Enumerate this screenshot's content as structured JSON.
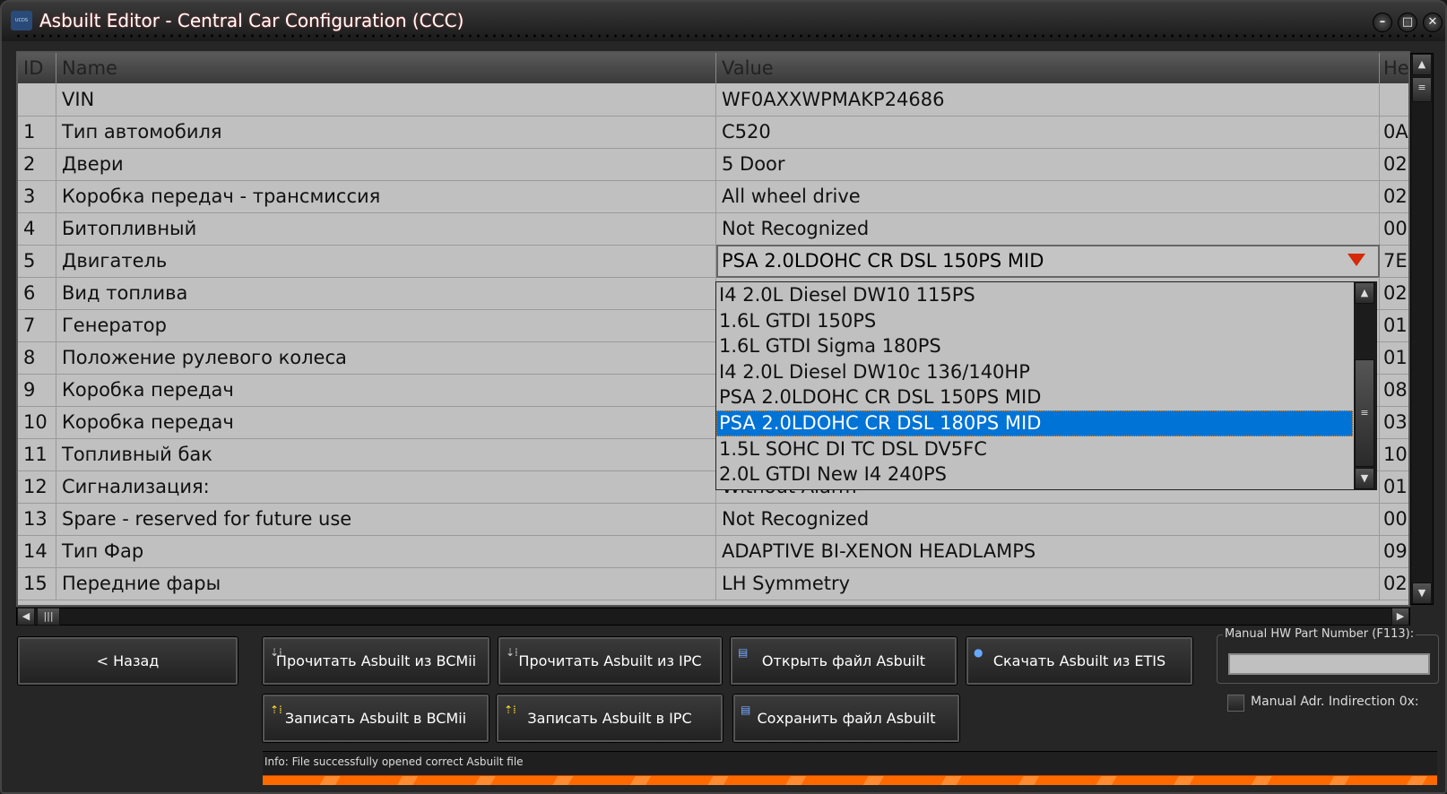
{
  "window": {
    "title": "Asbuilt Editor - Central Car Configuration (CCC)",
    "logo_text": "UCDS"
  },
  "table": {
    "columns": [
      "ID",
      "Name",
      "Value",
      "He"
    ],
    "rows": [
      {
        "id": "",
        "name": "VIN",
        "value": "WF0AXXWPMAKP24686",
        "hex": ""
      },
      {
        "id": "1",
        "name": "Тип автомобиля",
        "value": "C520",
        "hex": "0A"
      },
      {
        "id": "2",
        "name": "Двери",
        "value": "5 Door",
        "hex": "02"
      },
      {
        "id": "3",
        "name": "Коробка передач - трансмиссия",
        "value": "All wheel drive",
        "hex": "02"
      },
      {
        "id": "4",
        "name": "Битопливный",
        "value": "Not Recognized",
        "hex": "00"
      },
      {
        "id": "5",
        "name": "Двигатель",
        "value": "PSA 2.0LDOHC CR DSL 150PS MID",
        "hex": "7E"
      },
      {
        "id": "6",
        "name": "Вид топлива",
        "value": "",
        "hex": "02"
      },
      {
        "id": "7",
        "name": "Генератор",
        "value": "",
        "hex": "01"
      },
      {
        "id": "8",
        "name": "Положение рулевого колеса",
        "value": "",
        "hex": "01"
      },
      {
        "id": "9",
        "name": "Коробка передач",
        "value": "",
        "hex": "08"
      },
      {
        "id": "10",
        "name": "Коробка передач",
        "value": "",
        "hex": "03"
      },
      {
        "id": "11",
        "name": "Топливный бак",
        "value": "",
        "hex": "10"
      },
      {
        "id": "12",
        "name": "Сигнализация:",
        "value": "Without Alarm",
        "hex": "01"
      },
      {
        "id": "13",
        "name": "Spare - reserved for future use",
        "value": "Not Recognized",
        "hex": "00"
      },
      {
        "id": "14",
        "name": "Тип Фар",
        "value": "ADAPTIVE BI-XENON HEADLAMPS",
        "hex": "09"
      },
      {
        "id": "15",
        "name": "Передние фары",
        "value": "LH Symmetry",
        "hex": "02"
      }
    ]
  },
  "dropdown": {
    "options": [
      "I4 2.0L Diesel DW10 115PS",
      "1.6L GTDI 150PS",
      "1.6L GTDI Sigma 180PS",
      "I4 2.0L Diesel DW10c 136/140HP",
      "PSA 2.0LDOHC CR DSL 150PS MID",
      "PSA 2.0LDOHC CR DSL 180PS MID",
      "1.5L SOHC DI TC DSL DV5FC",
      "2.0L GTDI New I4 240PS"
    ],
    "highlighted": "PSA 2.0LDOHC CR DSL 180PS MID"
  },
  "buttons": {
    "back": "<  Назад",
    "read_bcm": "Прочитать Asbuilt из BCMii",
    "read_ipc": "Прочитать Asbuilt из IPC",
    "open_file": "Открыть файл Asbuilt",
    "download_etis": "Скачать Asbuilt из ETIS",
    "write_bcm": "Записать Asbuilt в BCMii",
    "write_ipc": "Записать Asbuilt в IPC",
    "save_file": "Сохранить файл Asbuilt"
  },
  "manual": {
    "hw_label": "Manual HW Part Number (F113):",
    "hw_value": "",
    "indirection_label": "Manual Adr. Indirection 0x:",
    "indirection_checked": false
  },
  "status": {
    "info": "Info: File successfully opened correct Asbuilt file",
    "progress_percent": 100
  },
  "colors": {
    "selection": "#0073d6",
    "progress": "#ff6a00",
    "arrow": "#d42a0a"
  }
}
